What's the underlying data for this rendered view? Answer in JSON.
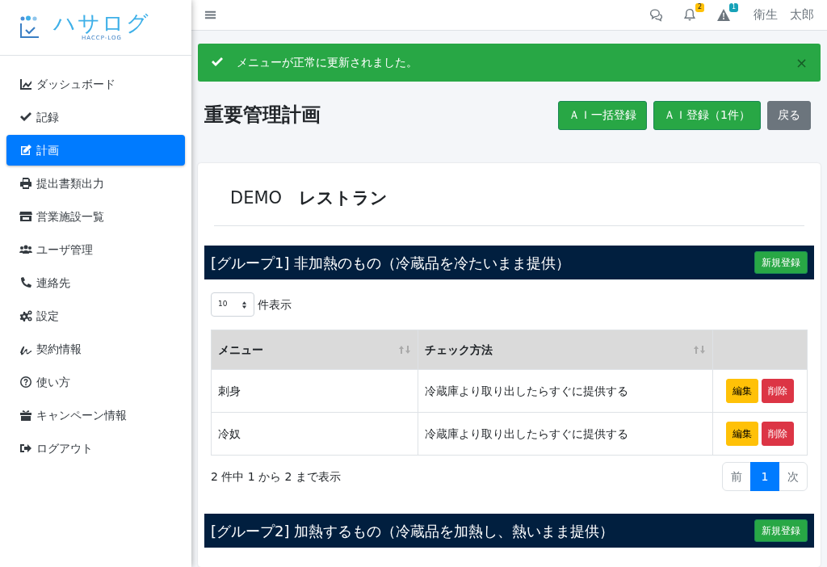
{
  "logo": {
    "name": "ハサログ",
    "subtitle": "HACCP-LOG"
  },
  "sidebar": {
    "items": [
      {
        "label": "ダッシュボード",
        "kind": "chart",
        "selected": false
      },
      {
        "label": "記録",
        "kind": "check",
        "selected": false
      },
      {
        "label": "計画",
        "kind": "edit",
        "selected": true
      },
      {
        "label": "提出書類出力",
        "kind": "print",
        "selected": false
      },
      {
        "label": "営業施設一覧",
        "kind": "store",
        "selected": false
      },
      {
        "label": "ユーザ管理",
        "kind": "users",
        "selected": false
      },
      {
        "label": "連絡先",
        "kind": "phone",
        "selected": false
      },
      {
        "label": "設定",
        "kind": "gears",
        "selected": false
      },
      {
        "label": "契約情報",
        "kind": "signature",
        "selected": false
      },
      {
        "label": "使い方",
        "kind": "question",
        "selected": false
      },
      {
        "label": "キャンペーン情報",
        "kind": "gift",
        "selected": false
      },
      {
        "label": "ログアウト",
        "kind": "logout",
        "selected": false
      }
    ]
  },
  "topbar": {
    "notifications": [
      {
        "kind": "chat"
      },
      {
        "kind": "bell",
        "count": "2",
        "color": "#ffc107"
      },
      {
        "kind": "warning",
        "count": "1",
        "color": "#17a2b8"
      }
    ],
    "user": "衛生　太郎"
  },
  "alert": {
    "message": "メニューが正常に更新されました。",
    "close": "×"
  },
  "page_title": "重要管理計画",
  "header_buttons": [
    {
      "label": "ＡＩ一括登録",
      "kind": "success"
    },
    {
      "label": "ＡＩ登録（1件）",
      "kind": "success"
    },
    {
      "label": "戻る",
      "kind": "secondary"
    }
  ],
  "card": {
    "title": "DEMO　**レストラン**",
    "groups": [
      {
        "title": "[グループ1] 非加熱のもの（冷蔵品を冷たいまま提供）",
        "button": "新規登録",
        "page_length": "10",
        "length_label": "件表示",
        "columns": [
          "メニュー",
          "チェック方法"
        ],
        "rows": [
          {
            "menu": "刺身",
            "method": "冷蔵庫より取り出したらすぐに提供する",
            "actions": [
              {
                "label": "編集",
                "kind": "warning"
              },
              {
                "label": "削除",
                "kind": "danger"
              }
            ]
          },
          {
            "menu": "冷奴",
            "method": "冷蔵庫より取り出したらすぐに提供する",
            "actions": [
              {
                "label": "編集",
                "kind": "warning"
              },
              {
                "label": "削除",
                "kind": "danger"
              }
            ]
          }
        ],
        "info": "2 件中 1 から 2 まで表示",
        "pagination": [
          {
            "label": "前",
            "selected": false
          },
          {
            "label": "1",
            "selected": true
          },
          {
            "label": "次",
            "selected": false
          }
        ]
      },
      {
        "title": "[グループ2] 加熱するもの（冷蔵品を加熱し、熱いまま提供）",
        "button": "新規登録"
      }
    ]
  }
}
